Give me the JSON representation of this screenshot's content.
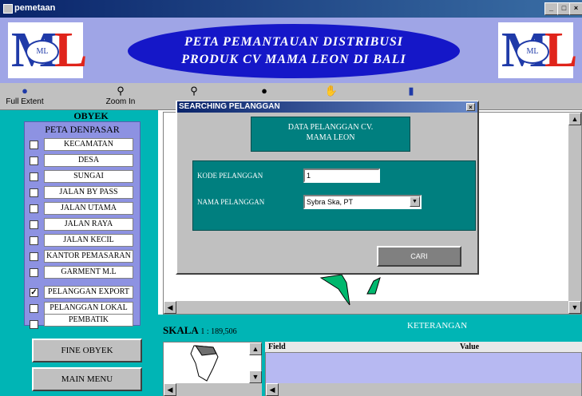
{
  "window": {
    "title": "pemetaan"
  },
  "banner": {
    "logo_letters": "ML",
    "title_line1": "PETA PEMANTAUAN DISTRIBUSI",
    "title_line2": "PRODUK CV MAMA LEON DI BALI"
  },
  "toolbar": {
    "full_extent": "Full Extent",
    "zoom_in": "Zoom In"
  },
  "left_panel": {
    "header": "OBYEK",
    "group_title": "PETA DENPASAR",
    "layers": [
      {
        "label": "KECAMATAN",
        "checked": false
      },
      {
        "label": "DESA",
        "checked": false
      },
      {
        "label": "SUNGAI",
        "checked": false
      },
      {
        "label": "JALAN BY PASS",
        "checked": false
      },
      {
        "label": "JALAN UTAMA",
        "checked": false
      },
      {
        "label": "JALAN RAYA",
        "checked": false
      },
      {
        "label": "JALAN KECIL",
        "checked": false
      },
      {
        "label": "KANTOR PEMASARAN",
        "checked": false
      },
      {
        "label": "GARMENT M.L",
        "checked": false
      }
    ],
    "customers": [
      {
        "label": "PELANGGAN EXPORT",
        "checked": true,
        "mark": "✓"
      },
      {
        "label": "PELANGGAN LOKAL",
        "checked": false
      },
      {
        "label": "PEMBATIK",
        "checked": false
      }
    ],
    "fine_button": "FINE OBYEK",
    "menu_button": "MAIN MENU"
  },
  "bottom": {
    "skala_label": "SKALA",
    "skala_value": "1 : 189,506",
    "keterangan": "KETERANGAN",
    "col_field": "Field",
    "col_value": "Value"
  },
  "dialog": {
    "title": "SEARCHING PELANGGAN",
    "close": "×",
    "header_line1": "DATA PELANGGAN CV.",
    "header_line2": "MAMA LEON",
    "kode_label": "KODE PELANGGAN",
    "kode_value": "1",
    "nama_label": "NAMA PELANGGAN",
    "nama_value": "Sybra Ska, PT",
    "cari_button": "CARI"
  },
  "colors": {
    "banner_bg": "#9fa5e6",
    "ellipse": "#1517c8",
    "teal_panel": "#00b5b5",
    "dialog_teal": "#007f7f"
  }
}
